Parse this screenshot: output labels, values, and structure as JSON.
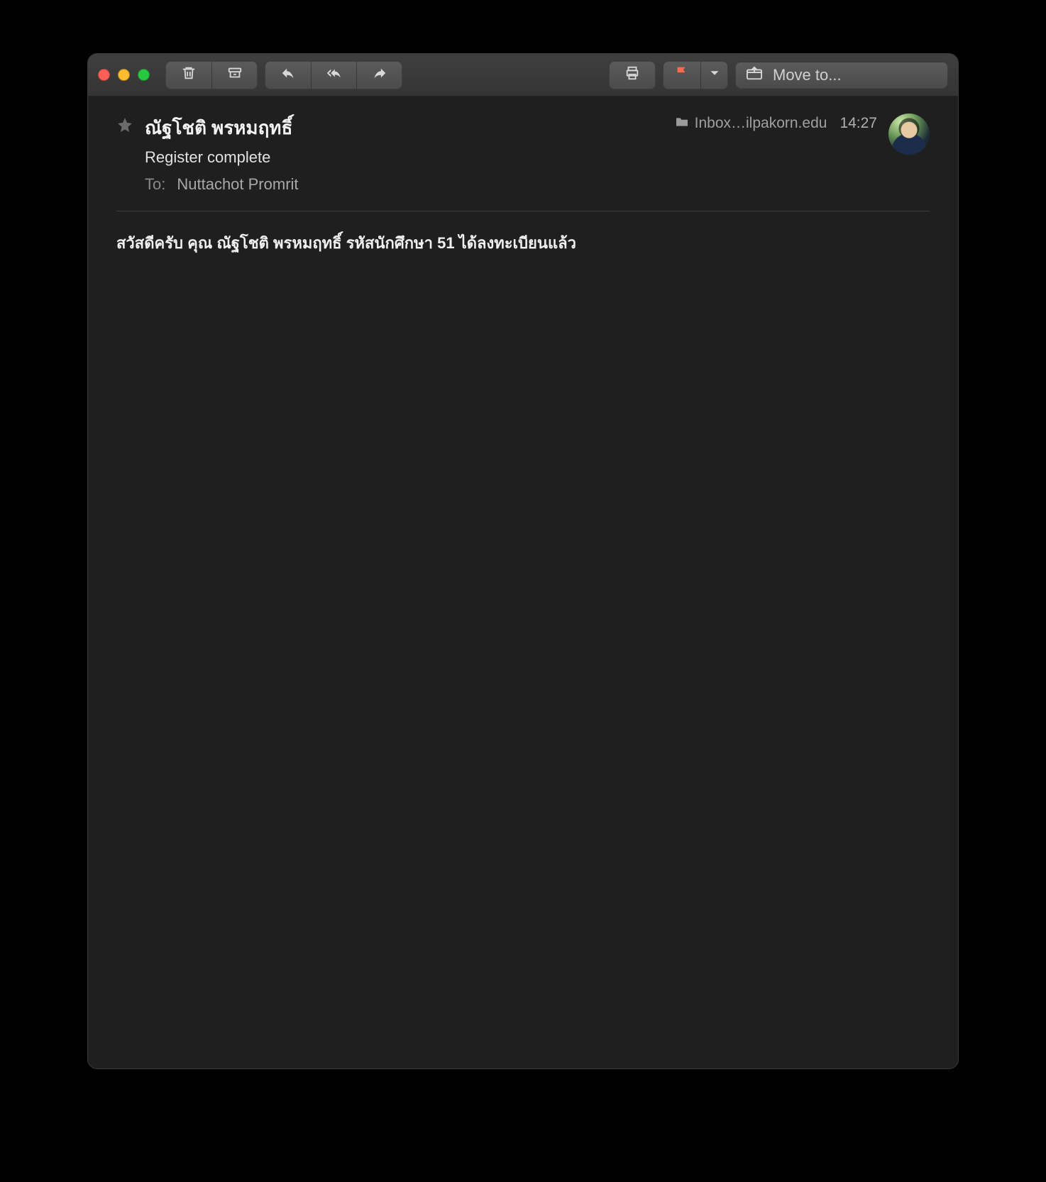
{
  "toolbar": {
    "move_label": "Move to..."
  },
  "message": {
    "sender": "ณัฐโชติ พรหมฤทธิ์",
    "subject": "Register complete",
    "to_label": "To:",
    "to_value": "Nuttachot Promrit",
    "folder": "Inbox…ilpakorn.edu",
    "time": "14:27",
    "body": "สวัสดีครับ คุณ ณัฐโชติ พรหมฤทธิ์ รหัสนักศึกษา 51 ได้ลงทะเบียนแล้ว"
  }
}
